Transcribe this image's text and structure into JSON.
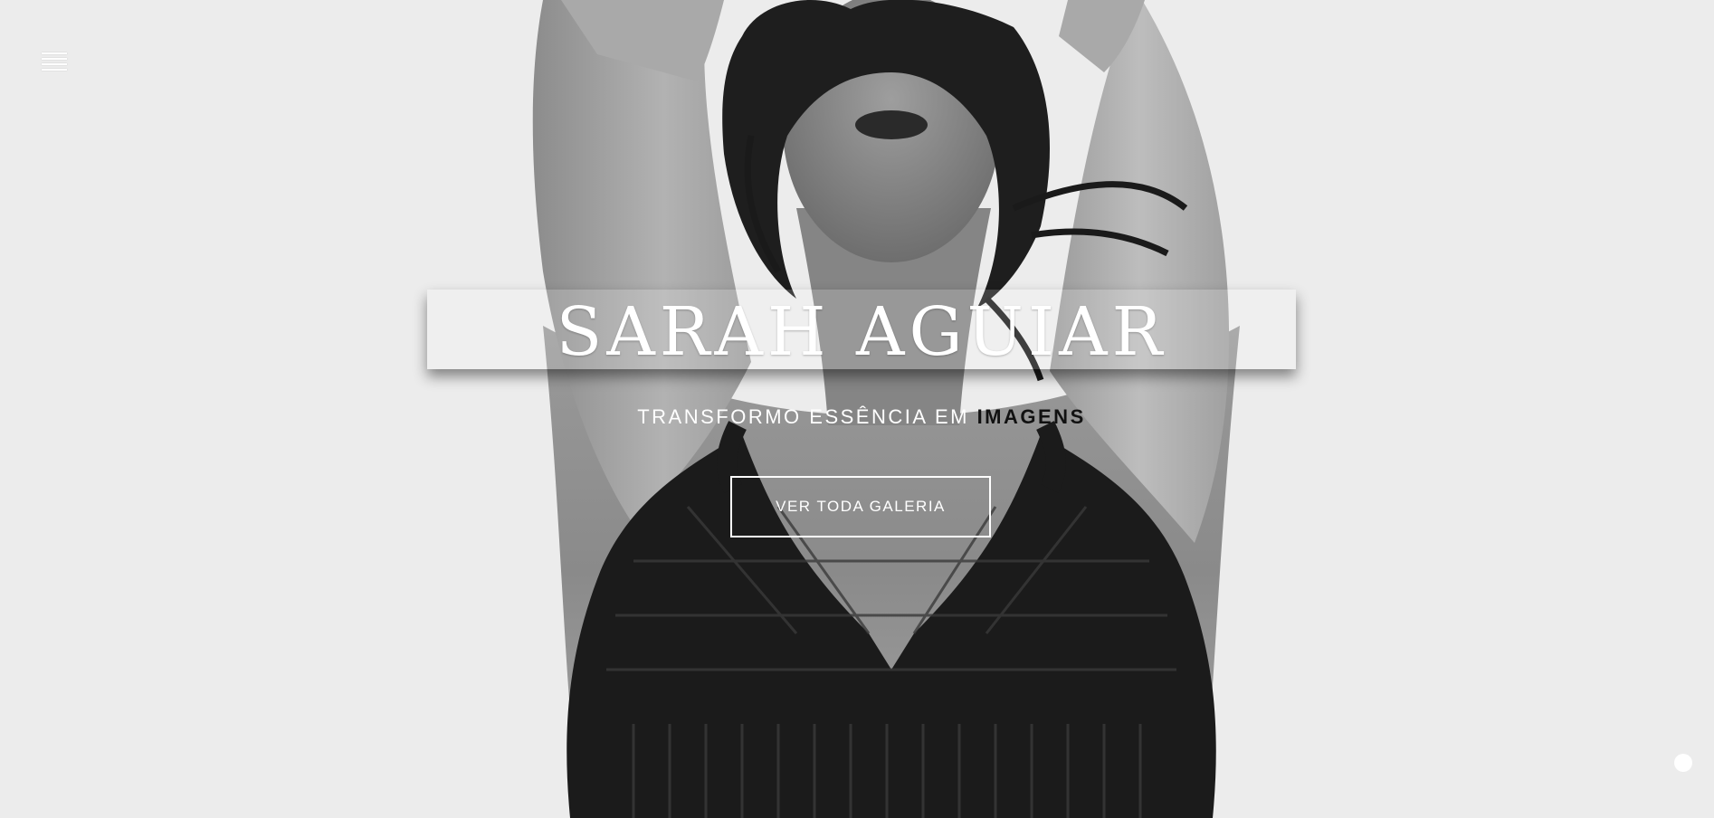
{
  "nav": {
    "menu_icon": "hamburger-menu-icon"
  },
  "hero": {
    "title": "SARAH AGUIAR",
    "tagline_main": "TRANSFORMO ESSÊNCIA EM ",
    "tagline_accent": "IMAGENS",
    "cta_label": "VER TODA GALERIA"
  },
  "colors": {
    "background": "#ececec",
    "title_text": "#ffffff",
    "tagline_accent": "#111111"
  },
  "widgets": {
    "scroll_top_icon": "circle-dot-icon"
  }
}
